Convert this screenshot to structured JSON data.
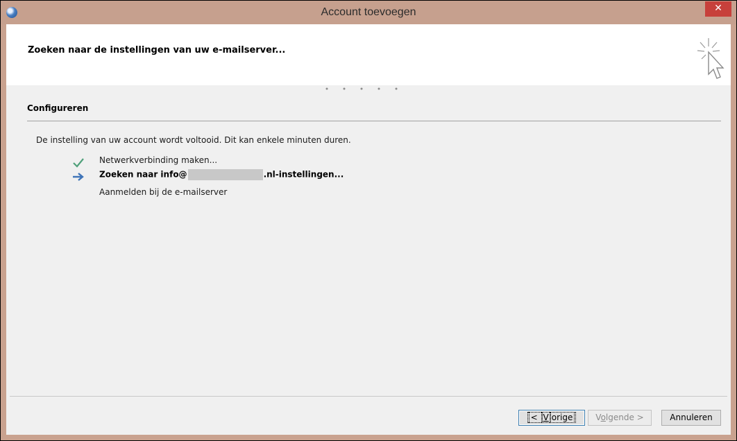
{
  "window": {
    "title": "Account toevoegen",
    "close_label": "✕"
  },
  "header": {
    "title": "Zoeken naar de instellingen van uw e-mailserver..."
  },
  "section": {
    "title": "Configureren",
    "info": "De instelling van uw account wordt voltooid. Dit kan enkele minuten duren."
  },
  "steps": [
    {
      "icon": "checkmark-icon",
      "label": "Netwerkverbinding maken...",
      "status": "done"
    },
    {
      "icon": "arrow-right-icon",
      "label_prefix": "Zoeken naar info@",
      "label_suffix": ".nl-instellingen...",
      "status": "active"
    },
    {
      "icon": "",
      "label": "Aanmelden bij de e-mailserver",
      "status": "pending"
    }
  ],
  "buttons": {
    "back": {
      "prefix": "< ",
      "accel": "V",
      "rest": "orige"
    },
    "next": {
      "prefix": "V",
      "accel": "o",
      "rest": "lgende >"
    },
    "cancel": "Annuleren"
  },
  "colors": {
    "titlebar": "#c6a08e",
    "close": "#c7403b",
    "check": "#4fa07a",
    "arrow": "#3f74b8"
  }
}
